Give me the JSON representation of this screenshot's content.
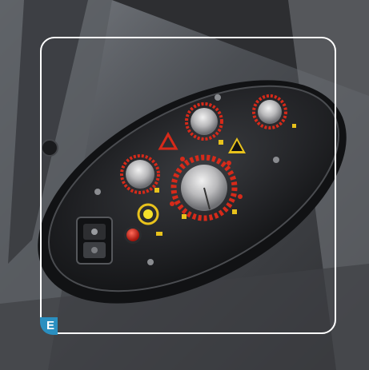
{
  "marker": {
    "label": "E",
    "color": "#2a8fc0"
  },
  "frame": {
    "color": "#ffffff"
  },
  "panel": {
    "knob_icons": [
      "knob-top-center-icon",
      "knob-top-right-icon",
      "knob-left-icon",
      "knob-large-center-icon"
    ],
    "buttons": [
      "red-push-button-icon",
      "rocker-switch-icon",
      "yellow-dial-icon"
    ],
    "accent_red": "#d62a1a",
    "accent_yellow": "#e8c21c"
  }
}
